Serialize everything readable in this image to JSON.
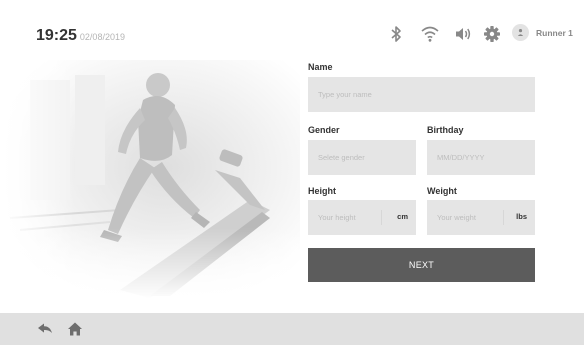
{
  "status": {
    "time": "19:25",
    "date": "02/08/2019",
    "icons": [
      "bluetooth-icon",
      "wifi-icon",
      "volume-icon",
      "settings-icon"
    ],
    "user": {
      "name": "Runner 1",
      "icon": "user-icon"
    }
  },
  "form": {
    "name": {
      "label": "Name",
      "placeholder": "Type your name"
    },
    "gender": {
      "label": "Gender",
      "placeholder": "Selete gender"
    },
    "birthday": {
      "label": "Birthday",
      "placeholder": "MM/DD/YYYY"
    },
    "height": {
      "label": "Height",
      "placeholder": "Your height",
      "unit": "cm"
    },
    "weight": {
      "label": "Weight",
      "placeholder": "Your weight",
      "unit": "lbs"
    },
    "next_label": "NEXT"
  },
  "bottom_bar": {
    "icons": [
      "back-icon",
      "home-icon"
    ]
  },
  "colors": {
    "field_bg": "#e5e5e5",
    "button_bg": "#5c5c5c",
    "bar_bg": "#e0e0e0"
  }
}
